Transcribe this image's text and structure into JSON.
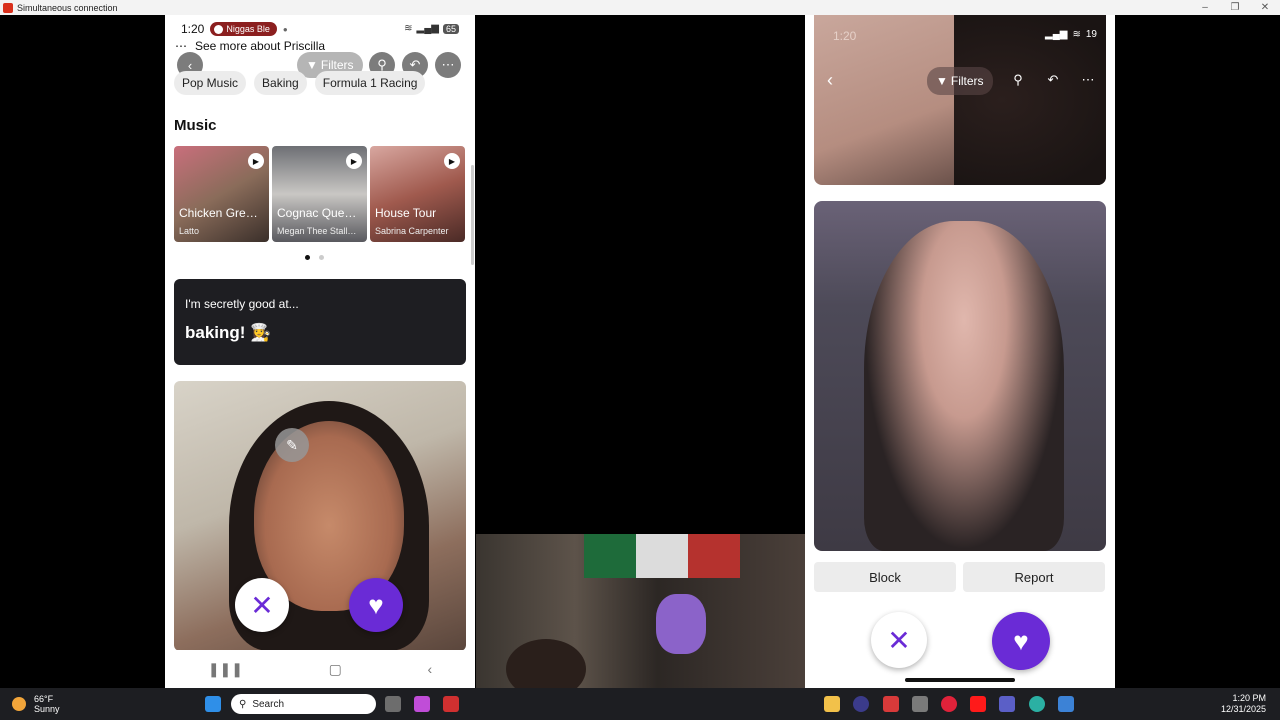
{
  "window": {
    "title": "Simultaneous connection"
  },
  "left_phone": {
    "status_time": "1:20",
    "notification_pill": "Niggas Ble",
    "battery": "65",
    "see_more": "See more about Priscilla",
    "filters_label": "Filters",
    "interests": [
      "Pop Music",
      "Baking",
      "Formula 1 Racing"
    ],
    "music_heading": "Music",
    "tracks": [
      {
        "title": "Chicken Gre…",
        "artist": "Latto"
      },
      {
        "title": "Cognac Que…",
        "artist": "Megan Thee Stall…"
      },
      {
        "title": "House Tour",
        "artist": "Sabrina Carpenter"
      }
    ],
    "prompt_question": "I'm secretly good at...",
    "prompt_answer": "baking! 👩‍🍳"
  },
  "right_phone": {
    "status_time": "1:20",
    "battery": "19",
    "filters_label": "Filters",
    "block_label": "Block",
    "report_label": "Report"
  },
  "taskbar": {
    "weather_temp": "66°F",
    "weather_desc": "Sunny",
    "search_placeholder": "Search",
    "time": "1:20 PM",
    "date": "12/31/2025"
  },
  "colors": {
    "accent": "#6a2bd6",
    "prompt_bg": "#1e1e22",
    "taskbar": "#1d1e22"
  }
}
